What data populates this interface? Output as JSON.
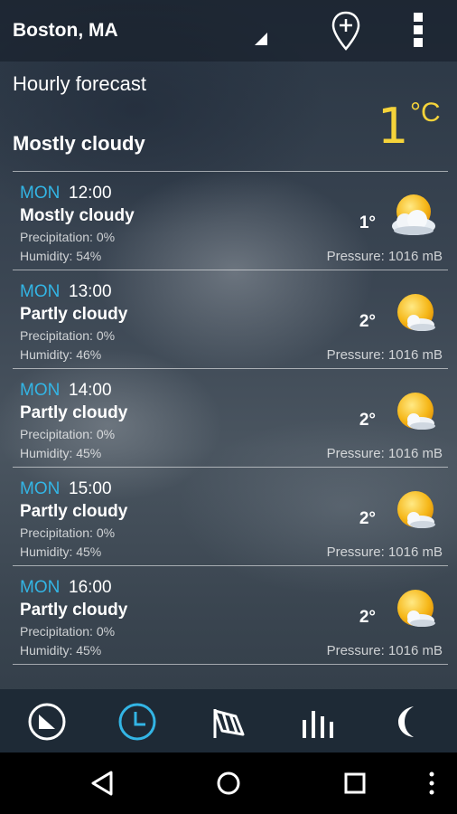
{
  "header": {
    "location": "Boston, MA",
    "add_location_icon": "location-add-icon",
    "menu_icon": "overflow-menu-icon"
  },
  "summary": {
    "title": "Hourly forecast",
    "current_temp": "1",
    "unit": "°C",
    "condition": "Mostly cloudy",
    "accent_color": "#f5d33a"
  },
  "hours": [
    {
      "day": "MON",
      "time": "12:00",
      "condition": "Mostly cloudy",
      "precipitation": "Precipitation: 0%",
      "humidity": "Humidity: 54%",
      "temp": "1°",
      "pressure": "Pressure: 1016 mB",
      "icon": "mostly-cloudy-icon"
    },
    {
      "day": "MON",
      "time": "13:00",
      "condition": "Partly cloudy",
      "precipitation": "Precipitation: 0%",
      "humidity": "Humidity: 46%",
      "temp": "2°",
      "pressure": "Pressure: 1016 mB",
      "icon": "partly-cloudy-icon"
    },
    {
      "day": "MON",
      "time": "14:00",
      "condition": "Partly cloudy",
      "precipitation": "Precipitation: 0%",
      "humidity": "Humidity: 45%",
      "temp": "2°",
      "pressure": "Pressure: 1016 mB",
      "icon": "partly-cloudy-icon"
    },
    {
      "day": "MON",
      "time": "15:00",
      "condition": "Partly cloudy",
      "precipitation": "Precipitation: 0%",
      "humidity": "Humidity: 45%",
      "temp": "2°",
      "pressure": "Pressure: 1016 mB",
      "icon": "partly-cloudy-icon"
    },
    {
      "day": "MON",
      "time": "16:00",
      "condition": "Partly cloudy",
      "precipitation": "Precipitation: 0%",
      "humidity": "Humidity: 45%",
      "temp": "2°",
      "pressure": "Pressure: 1016 mB",
      "icon": "partly-cloudy-icon"
    }
  ],
  "tabs": [
    {
      "icon": "current-conditions-icon",
      "active": false
    },
    {
      "icon": "clock-icon",
      "active": true
    },
    {
      "icon": "windsock-icon",
      "active": false
    },
    {
      "icon": "chart-bars-icon",
      "active": false
    },
    {
      "icon": "moon-icon",
      "active": false
    }
  ],
  "colors": {
    "day_label": "#33b5e5",
    "active_tab": "#33b5e5"
  },
  "system_nav": [
    "back-icon",
    "home-icon",
    "recents-icon",
    "more-icon"
  ]
}
